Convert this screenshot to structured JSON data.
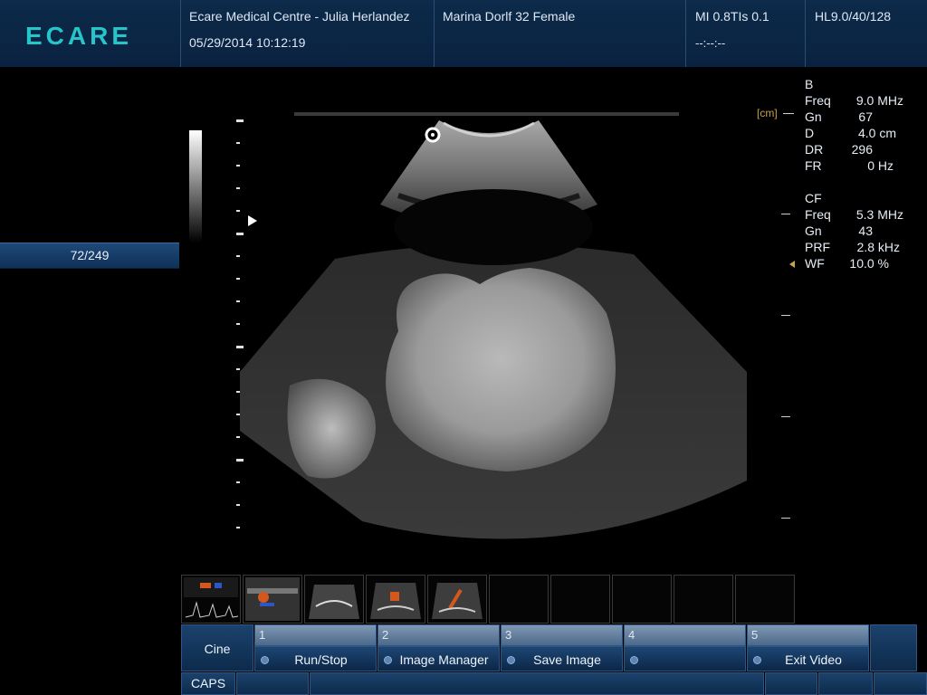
{
  "header": {
    "logo": "ECARE",
    "facility": "Ecare Medical Centre - Julia Herlandez",
    "datetime": "05/29/2014 10:12:19",
    "patient": "Marina Dorlf 32 Female",
    "mi_tis": "MI 0.8TIs 0.1",
    "timer": "--:--:--",
    "probe": "HL9.0/40/128"
  },
  "left": {
    "frame_counter": "72/249"
  },
  "scale": {
    "unit": "[cm]"
  },
  "b_mode": {
    "title": "B",
    "params": [
      {
        "label": "Freq",
        "value": "9.0 MHz"
      },
      {
        "label": "Gn",
        "value": "67"
      },
      {
        "label": "D",
        "value": "4.0 cm"
      },
      {
        "label": "DR",
        "value": "296"
      },
      {
        "label": "FR",
        "value": "0 Hz"
      }
    ]
  },
  "cf_mode": {
    "title": "CF",
    "params": [
      {
        "label": "Freq",
        "value": "5.3 MHz"
      },
      {
        "label": "Gn",
        "value": "43"
      },
      {
        "label": "PRF",
        "value": "2.8 kHz"
      },
      {
        "label": "WF",
        "value": "10.0 %"
      }
    ]
  },
  "toolbar": {
    "cine_label": "Cine",
    "caps_label": "CAPS",
    "functions": [
      {
        "num": "1",
        "label": "Run/Stop"
      },
      {
        "num": "2",
        "label": "Image Manager"
      },
      {
        "num": "3",
        "label": "Save Image"
      },
      {
        "num": "4",
        "label": ""
      },
      {
        "num": "5",
        "label": "Exit Video"
      }
    ]
  },
  "colors": {
    "panel": "#0d2a4a",
    "logo": "#27c4c9",
    "button": "#1b426d",
    "function_number": "#6f89a8"
  }
}
